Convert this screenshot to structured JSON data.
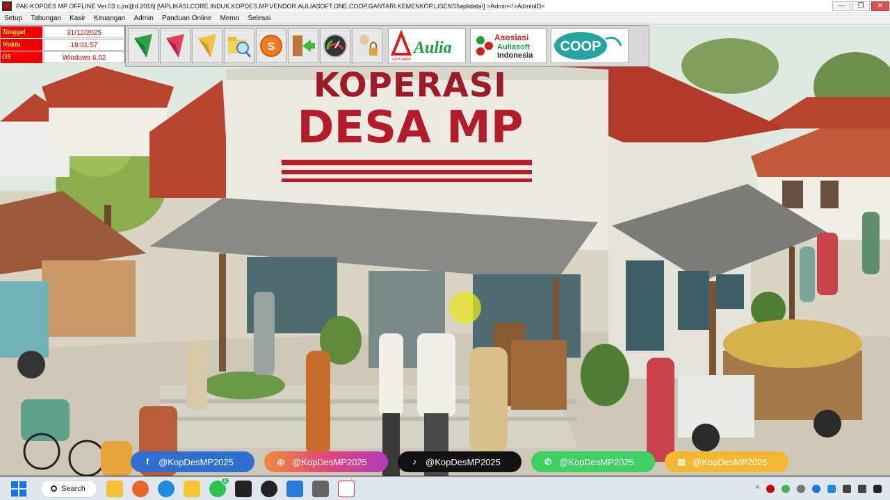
{
  "window": {
    "title": "PAK-KOPDES MP OFFLINE Ver.03 c.|m@d.2016| [\\APLIKASI.CORE.INDUK.KOPDES.MP.VENDOR.AULIASOFT.ONE.COOP.GANTARI.KEMENKOP.LISENSI\\aplidata\\] >Admin<!>AdminID<",
    "min": "—",
    "max": "❐",
    "close": "✕"
  },
  "menu": [
    "Setup",
    "Tabungan",
    "Kasir",
    "Keuangan",
    "Admin",
    "Panduan Online",
    "Memo",
    "Selesai"
  ],
  "info": {
    "tanggal_label": "Tanggal",
    "tanggal_value": "31/12/2025",
    "waktu_label": "Waktu",
    "waktu_value": "19:01:57",
    "os_label": "OS",
    "os_value": "Windows 6.02"
  },
  "toolbar_icons": [
    "green-arrow-icon",
    "red-arrow-icon",
    "yellow-arrow-icon",
    "folder-search-icon",
    "s-coin-icon",
    "exit-door-icon",
    "gauge-icon",
    "user-lock-icon"
  ],
  "logos": {
    "aulia_text": "Aulia",
    "aulia_software": "SOFTWARE",
    "asosiasi_line1": "Asosiasi",
    "asosiasi_line2": "Auliasoft",
    "asosiasi_line3": "Indonesia",
    "coop_text": "COOP"
  },
  "scene": {
    "sign_line1": "KOPERASI",
    "sign_line2": "DESA MP"
  },
  "socials": [
    {
      "handle": "@KopDesMP2025",
      "icon": "f"
    },
    {
      "handle": "@KopDesMP2025",
      "icon": "◎"
    },
    {
      "handle": "@KopDesMP2025",
      "icon": "♪"
    },
    {
      "handle": "@KopDesMP2025",
      "icon": "✆"
    },
    {
      "handle": "@KopDesMP2025",
      "icon": "▤"
    }
  ],
  "taskbar": {
    "search_label": "Search",
    "badge": "4"
  },
  "colors": {
    "label_bg": "#e00000",
    "label_fg": "#ffeb3b",
    "value_fg": "#cc0000",
    "roof": "#b8432e",
    "sign": "#b31d2b"
  }
}
